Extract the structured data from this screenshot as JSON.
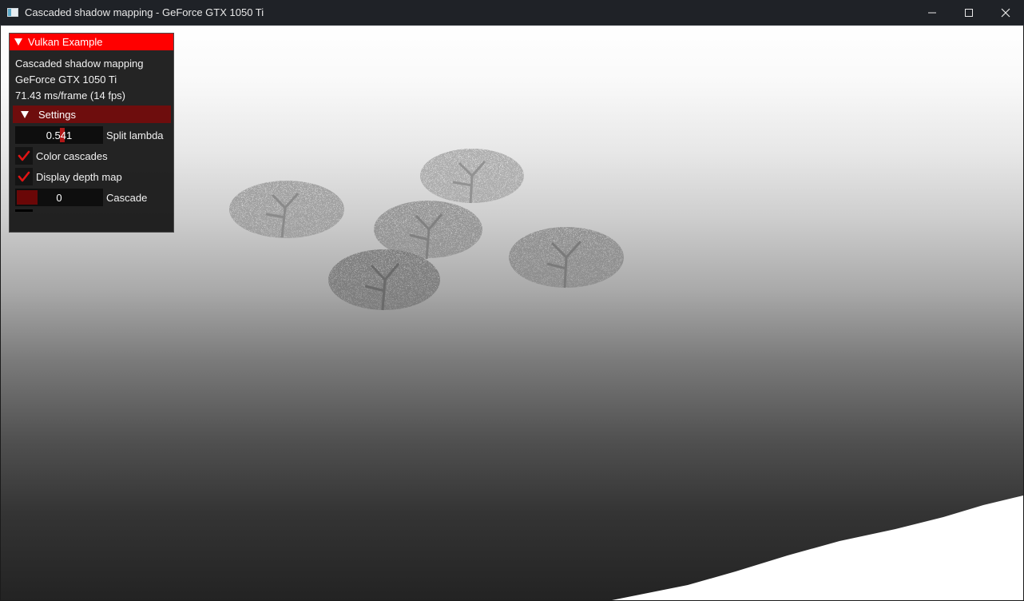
{
  "window": {
    "title": "Cascaded shadow mapping - GeForce GTX 1050 Ti",
    "app_icon": "vulkan-app-icon",
    "controls": [
      "minimize-icon",
      "maximize-icon",
      "close-icon"
    ]
  },
  "panel": {
    "title": "Vulkan Example",
    "info": {
      "example_name": "Cascaded shadow mapping",
      "device_name": "GeForce GTX 1050 Ti",
      "frame_time": "71.43 ms/frame (14 fps)"
    },
    "settings": {
      "header": "Settings",
      "split_lambda": {
        "value": "0.541",
        "level": 0.541,
        "label": "Split lambda"
      },
      "color_cascades": {
        "checked": true,
        "label": "Color cascades"
      },
      "display_depth_map": {
        "checked": true,
        "label": "Display depth map"
      },
      "cascade": {
        "value": "0",
        "label": "Cascade"
      }
    }
  },
  "colors": {
    "title_bar": "#1f2227",
    "panel_header": "#ff0000",
    "settings_header": "#6e0d0d",
    "accent": "#b01818",
    "checkmark": "#e01414"
  }
}
